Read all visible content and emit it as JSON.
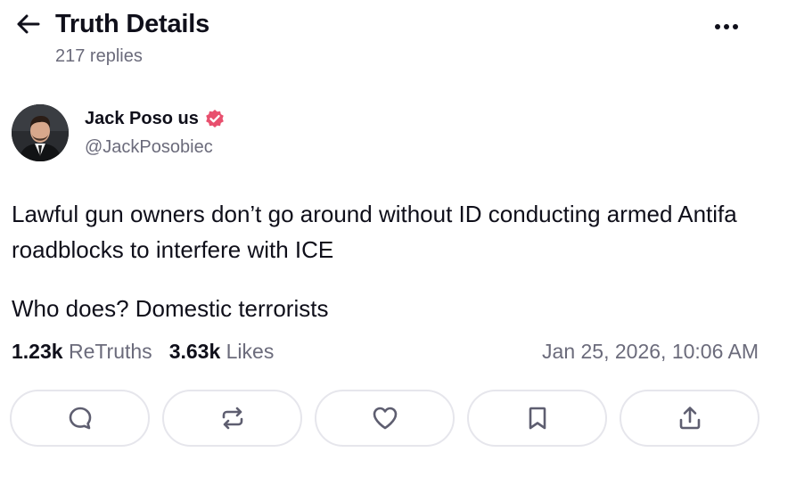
{
  "header": {
    "back_icon": "arrow-left-icon",
    "title": "Truth Details",
    "replies": "217 replies",
    "more_icon": "more-horizontal-icon"
  },
  "post": {
    "author": {
      "name": "Jack Poso us",
      "handle": "@JackPosobiec",
      "verified_icon": "verified-badge-icon",
      "verified_color": "#e8506e"
    },
    "text": [
      "Lawful gun owners don’t go around without ID conducting armed Antifa roadblocks to interfere with ICE",
      "Who does? Domestic terrorists"
    ],
    "stats": {
      "retruths_count": "1.23k",
      "retruths_label": "ReTruths",
      "likes_count": "3.63k",
      "likes_label": "Likes"
    },
    "timestamp": "Jan 25, 2026, 10:06 AM"
  },
  "actions": [
    {
      "icon": "reply-icon"
    },
    {
      "icon": "retruth-icon"
    },
    {
      "icon": "heart-icon"
    },
    {
      "icon": "bookmark-icon"
    },
    {
      "icon": "share-icon"
    }
  ],
  "colors": {
    "text_primary": "#0f0f1a",
    "text_secondary": "#6b6b7b",
    "border": "#e6e6ec",
    "icon": "#5e5e70"
  }
}
